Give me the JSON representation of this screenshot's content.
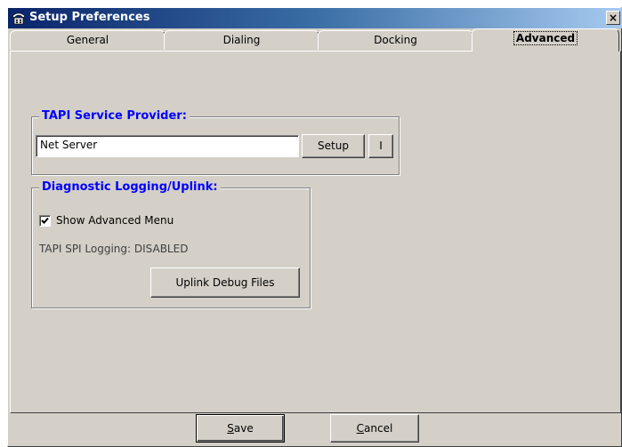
{
  "window": {
    "title": "Setup Preferences",
    "close_label": "×"
  },
  "tabs": [
    {
      "label": "General",
      "active": false
    },
    {
      "label": "Dialing",
      "active": false
    },
    {
      "label": "Docking",
      "active": false
    },
    {
      "label": "Advanced",
      "active": true
    }
  ],
  "tapi": {
    "legend": "TAPI Service Provider:",
    "provider_value": "Net Server",
    "setup_label": "Setup",
    "info_label": "I"
  },
  "diagnostic": {
    "legend": "Diagnostic Logging/Uplink:",
    "show_advanced_label": "Show Advanced Menu",
    "show_advanced_checked": true,
    "logging_status": "TAPI SPI Logging: DISABLED",
    "uplink_label": "Uplink Debug Files"
  },
  "footer": {
    "save_prefix": "",
    "save_mnemonic": "S",
    "save_rest": "ave",
    "cancel_mnemonic": "C",
    "cancel_rest": "ancel"
  },
  "colors": {
    "dialog_bg": "#d4d0c8",
    "legend_text": "#0000ff",
    "title_gradient_start": "#0a246a",
    "title_gradient_end": "#a6caf0"
  },
  "icons": {
    "title": "telephone-icon",
    "checkbox": "check-icon"
  }
}
